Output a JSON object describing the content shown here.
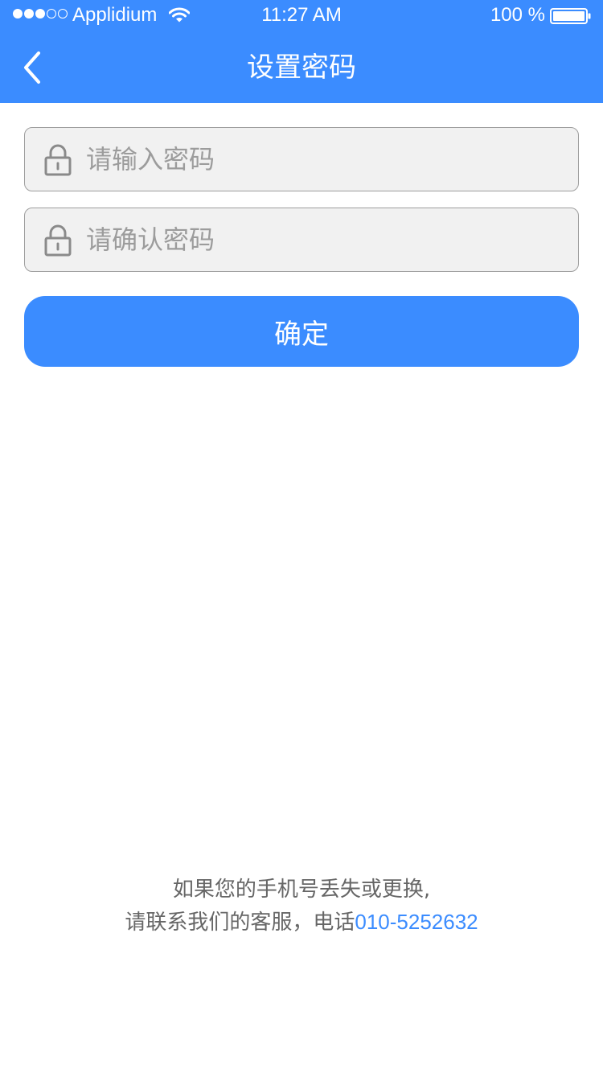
{
  "status_bar": {
    "carrier": "Applidium",
    "time": "11:27 AM",
    "battery": "100 %",
    "signal_dots": [
      "full",
      "full",
      "full",
      "empty",
      "empty"
    ],
    "icons": [
      "wifi-icon",
      "battery-icon"
    ]
  },
  "nav": {
    "title": "设置密码",
    "back_icon": "chevron-left-icon"
  },
  "form": {
    "password": {
      "value": "",
      "placeholder": "请输入密码",
      "icon": "lock-icon"
    },
    "confirm_password": {
      "value": "",
      "placeholder": "请确认密码",
      "icon": "lock-icon"
    },
    "submit_label": "确定"
  },
  "help": {
    "line1": "如果您的手机号丢失或更换,",
    "line2_prefix": "请联系我们的客服，电话",
    "phone": "010-5252632"
  },
  "colors": {
    "primary": "#3b8cff",
    "input_bg": "#f1f1f1",
    "input_border": "#9e9e9e",
    "placeholder": "#9c9c9c",
    "help_text": "#666666"
  }
}
